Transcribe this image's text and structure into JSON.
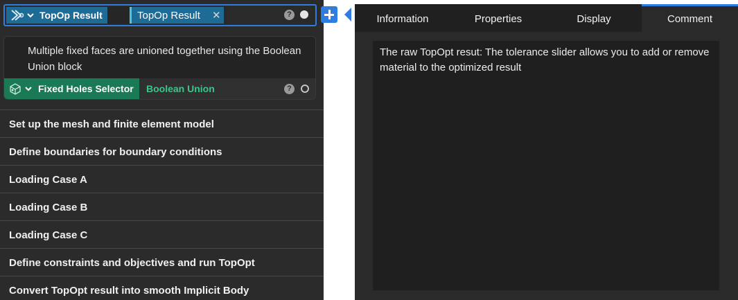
{
  "main_block": {
    "title": "TopOp Result",
    "input_chip": "TopOp Result",
    "help_label": "?",
    "remove_chip_glyph": "✕",
    "icon": "topop-block-icon"
  },
  "sub_block": {
    "comment": "Multiple fixed faces are unioned together using the Boolean Union block",
    "title": "Fixed Holes Selector",
    "link": "Boolean Union",
    "help_label": "?",
    "icon": "face-selector-icon"
  },
  "groups": [
    {
      "label": "Set up the mesh and finite element model"
    },
    {
      "label": "Define boundaries for boundary conditions"
    },
    {
      "label": "Loading Case A"
    },
    {
      "label": "Loading Case B"
    },
    {
      "label": "Loading Case C"
    },
    {
      "label": "Define constraints and objectives and run TopOpt"
    },
    {
      "label": "Convert TopOpt result into smooth Implicit Body"
    }
  ],
  "inspector": {
    "tabs": [
      {
        "label": "Information"
      },
      {
        "label": "Properties"
      },
      {
        "label": "Display"
      },
      {
        "label": "Comment",
        "active": true
      }
    ],
    "comment": "The raw TopOpt resut: The tolerance slider allows you to add or remove material to the optimized result"
  },
  "colors": {
    "accent": "#2f7de1",
    "block_blue": "#1e6c96",
    "block_green": "#1a7a55",
    "link_green": "#3cc48c",
    "panel_bg": "#2b2b2b"
  }
}
